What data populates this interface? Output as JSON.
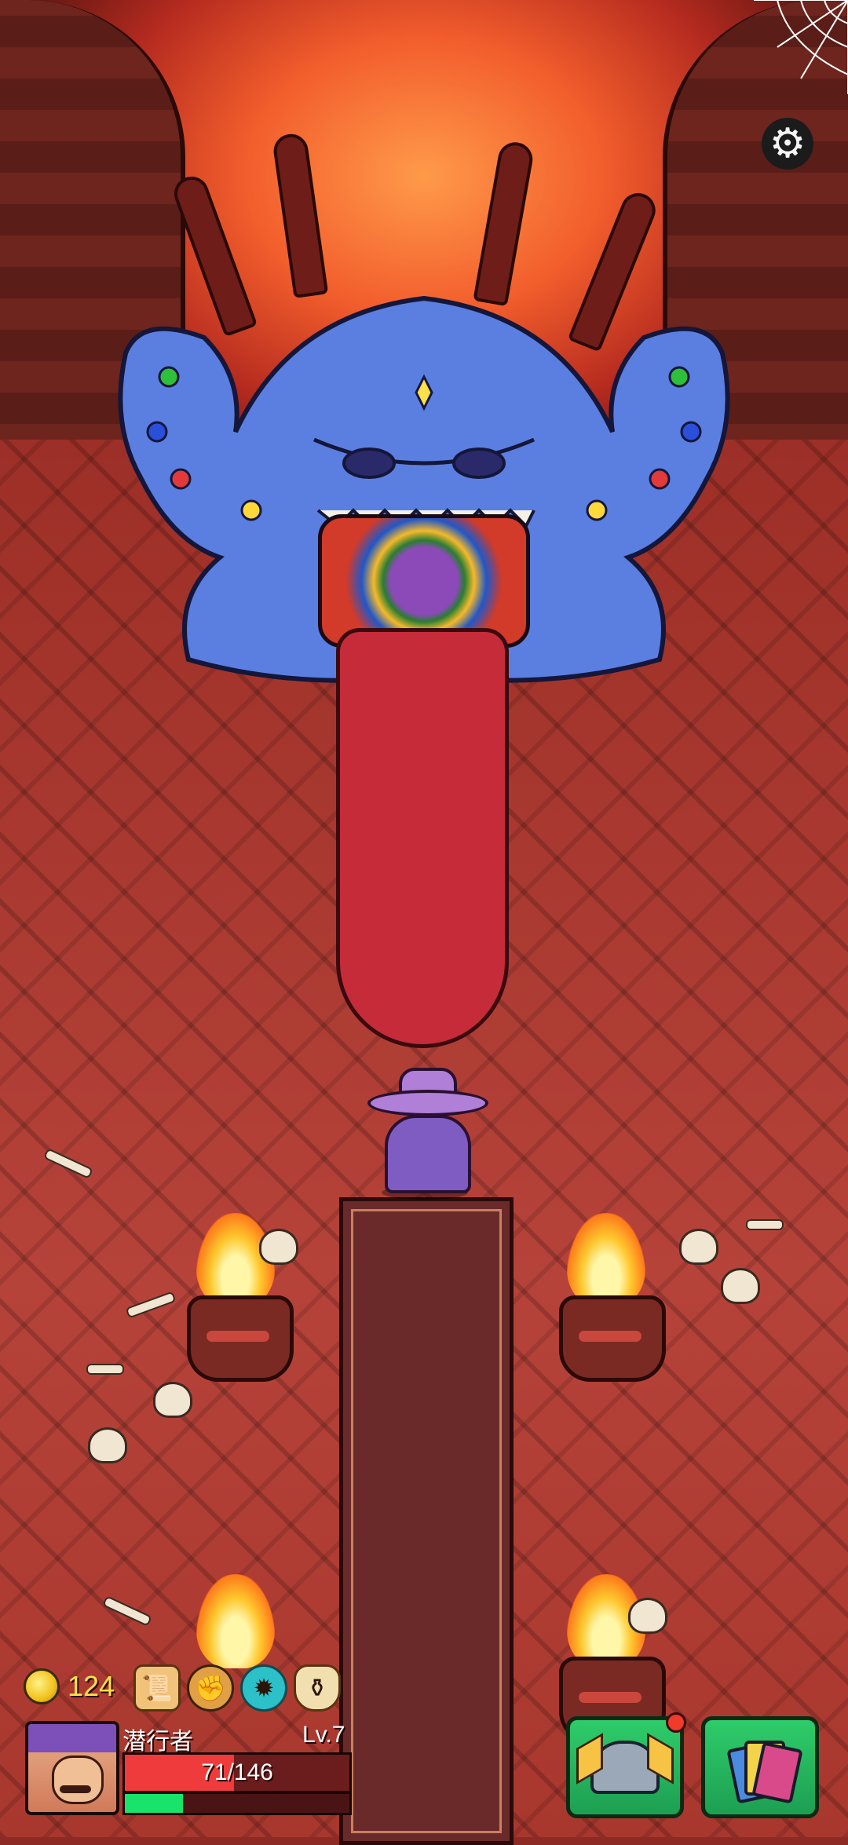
{
  "hud": {
    "coins": "124",
    "player_name": "潜行者",
    "level": "Lv.7",
    "hp_text": "71/146",
    "hp_fraction": 0.486,
    "xp_fraction": 0.26,
    "relics": [
      "scroll-relic-icon",
      "fist-relic-icon",
      "sun-relic-icon",
      "bag-relic-icon"
    ]
  },
  "buttons": {
    "deck_icon": "winged-helmet-icon",
    "cards_icon": "card-stack-icon",
    "deck_has_notification": true
  },
  "settings": {
    "icon": "gear-icon",
    "glyph": "⚙"
  },
  "colors": {
    "hp": "#ef3b3b",
    "xp": "#19e36b",
    "coin": "#ffe24a",
    "button": "#2ecc6a"
  }
}
